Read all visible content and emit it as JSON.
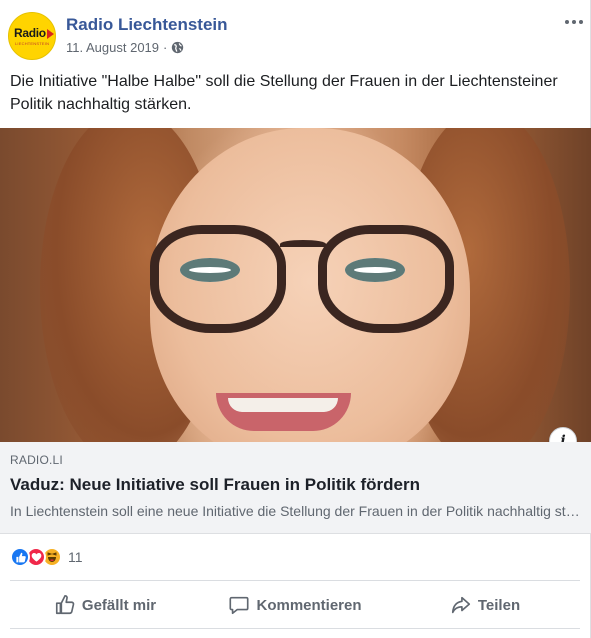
{
  "post": {
    "author": "Radio Liechtenstein",
    "avatar_logo_text": "Radio",
    "avatar_logo_subtext": "LIECHTENSTEIN",
    "date": "11. August 2019",
    "separator": "·",
    "privacy_icon": "globe-icon",
    "more_icon": "more-options-icon",
    "text": "Die Initiative \"Halbe Halbe\" soll die Stellung der Frauen in der Liechtensteiner Politik nachhaltig stärken."
  },
  "link_preview": {
    "info_label": "i",
    "domain": "RADIO.LI",
    "title": "Vaduz: Neue Initiative soll Frauen in Politik fördern",
    "description": "In Liechtenstein soll eine neue Initiative die Stellung der Frauen in der Politik nachhaltig stärken."
  },
  "reactions": {
    "icons": [
      "like-icon",
      "love-icon",
      "haha-icon"
    ],
    "count": "11"
  },
  "actions": {
    "like_label": "Gefällt mir",
    "comment_label": "Kommentieren",
    "share_label": "Teilen"
  },
  "colors": {
    "page_name": "#385898",
    "like": "#1877f2",
    "love": "#f0284a",
    "haha": "#f7b125",
    "avatar_bg": "#ffd400"
  }
}
